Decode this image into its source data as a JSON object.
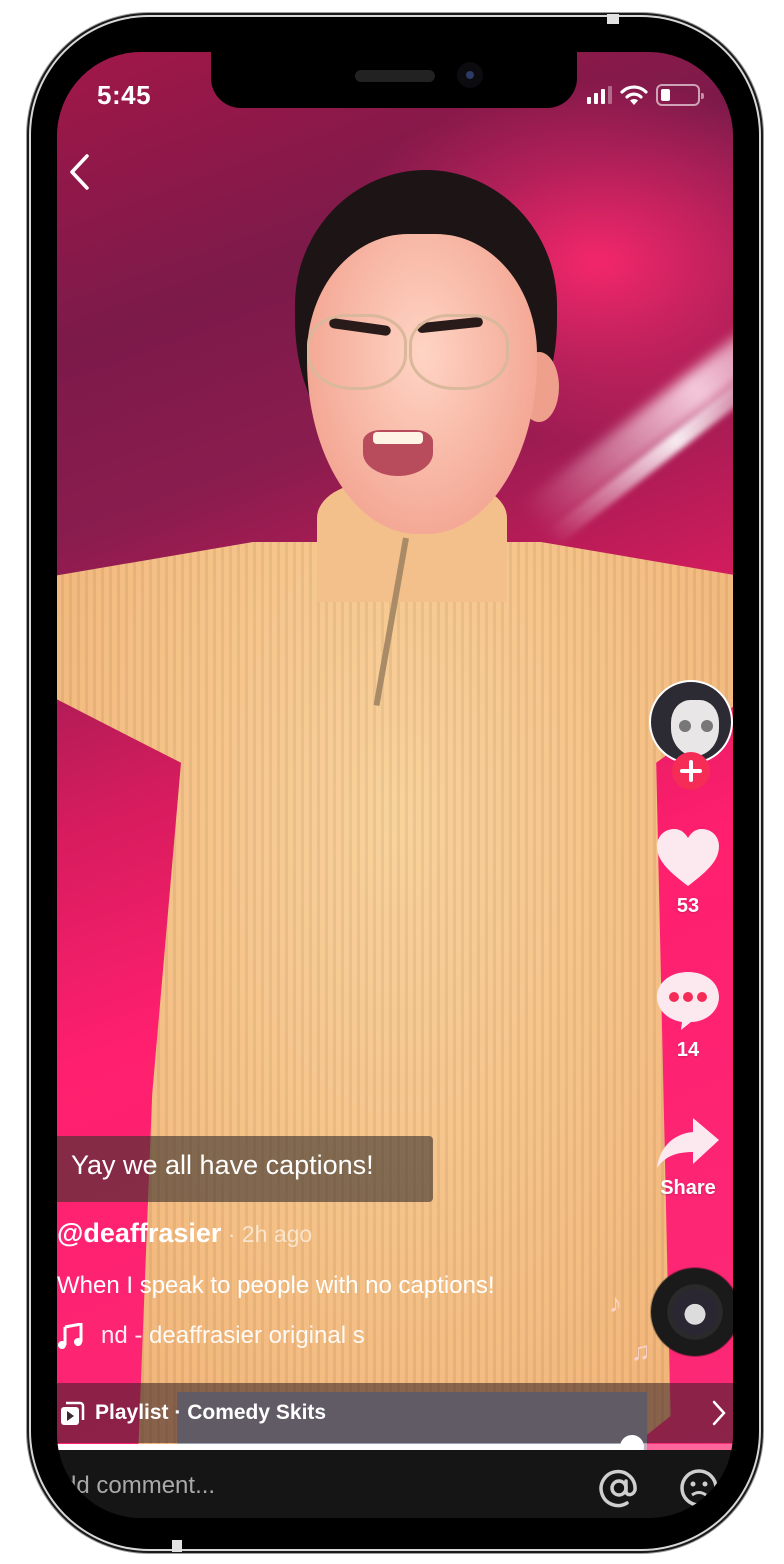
{
  "status_bar": {
    "time": "5:45",
    "signal_bars_active": 3,
    "signal_bars_total": 4,
    "wifi": true,
    "battery_level": 0.25
  },
  "nav": {
    "back_icon": "chevron-left-icon"
  },
  "video": {
    "caption_overlay": "Yay we all have captions!"
  },
  "post": {
    "author": "@deaffrasier",
    "separator": " · ",
    "time_ago": "2h ago",
    "description": "When I speak to people with no captions!",
    "sound_icon": "music-note-icon",
    "sound_text": "nd - deaffrasier    original s"
  },
  "actions": {
    "follow_icon": "plus-icon",
    "like_count": "53",
    "comment_count": "14",
    "share_label": "Share"
  },
  "playlist": {
    "label": "Playlist · Comedy Skits"
  },
  "playback": {
    "progress": 0.85
  },
  "comment": {
    "placeholder": "Add comment..."
  },
  "colors": {
    "accent": "#f52c56",
    "video_bg": "#ff1f6e",
    "comment_bar": "#151515"
  }
}
